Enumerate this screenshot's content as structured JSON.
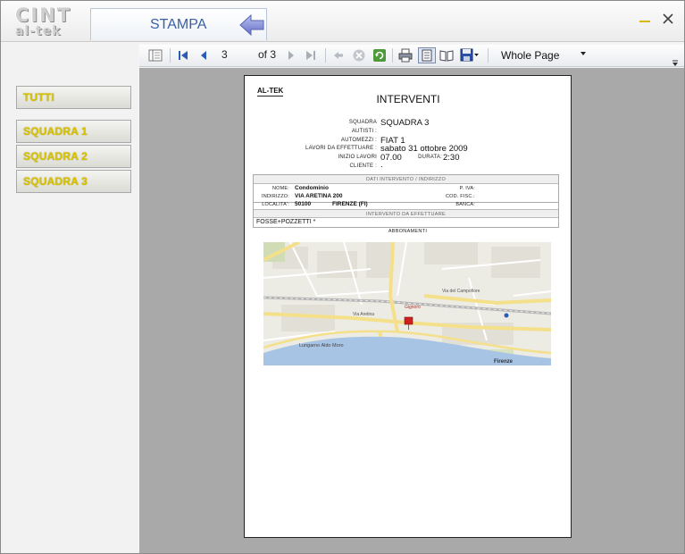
{
  "header": {
    "logo_line1": "CINT",
    "logo_line2": "al-tek",
    "tab_label": "STAMPA"
  },
  "sidebar": {
    "items": [
      {
        "label": "TUTTI"
      },
      {
        "label": "SQUADRA 1"
      },
      {
        "label": "SQUADRA 2"
      },
      {
        "label": "SQUADRA 3"
      }
    ]
  },
  "toolbar": {
    "current_page": "3",
    "of_label": "of",
    "total_pages": "3",
    "zoom_value": "Whole Page"
  },
  "report": {
    "company": "AL-TEK",
    "title": "INTERVENTI",
    "info": {
      "squadra_label": "SQUADRA",
      "squadra_value": "SQUADRA 3",
      "autisti_label": "AUTISTI :",
      "automezzi_label": "AUTOMEZZI :",
      "automezzi_value": "FIAT 1",
      "lavori_label": "LAVORI DA EFFETTUARE :",
      "lavori_value": "sabato 31 ottobre 2009",
      "inizio_label": "INIZIO LAVORI",
      "inizio_value": "07.00",
      "durata_label": "DURATA:",
      "durata_value": "2:30",
      "cliente_label": "CLIENTE :",
      "cliente_value": "."
    },
    "box": {
      "header1": "DATI INTERVENTO / INDIRIZZO",
      "nome_label": "NOME:",
      "nome_value": "Condominio",
      "piva_label": "P. IVA:",
      "indirizzo_label": "INDIRIZZO:",
      "indirizzo_value": "VIA ARETINA 200",
      "codfisc_label": "COD. FISC.:",
      "localita_label": "LOCALITA':",
      "cap_value": "50100",
      "citta_value": "FIRENZE (FI)",
      "banca_label": "BANCA:",
      "header2": "INTERVENTO DA EFFETTUARE",
      "note": "FOSSE+POZZETTI *"
    },
    "abbonamenti": "ABBONAMENTI",
    "map_labels": {
      "firenze": "Firenze",
      "lungarno": "Lungarno Aldo Moro",
      "via_aretina": "Via Aretina",
      "gignoro": "Gignoro",
      "campofiore": "Via del Campofiore"
    }
  },
  "colors": {
    "button_text": "#d9c400",
    "tab_text": "#3a5fa8",
    "preview_bg": "#a9a9a9",
    "river": "#a8c4e4",
    "map_road": "#f7e9a0"
  }
}
